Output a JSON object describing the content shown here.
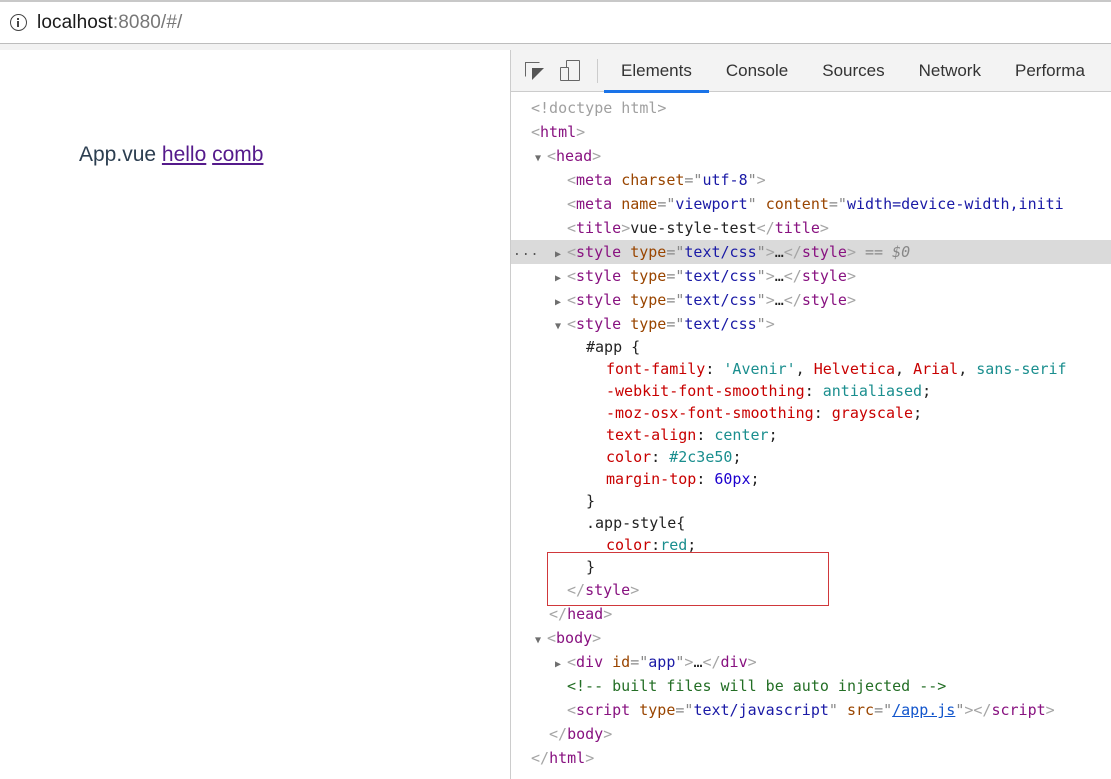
{
  "addressbar": {
    "icon": "info-icon",
    "url_host": "localhost",
    "url_rest": ":8080/#/"
  },
  "page": {
    "text_prefix": "App.vue",
    "links": [
      "hello",
      "comb"
    ]
  },
  "devtools": {
    "toolbar": {
      "icons": [
        "inspect-element-icon",
        "device-toggle-icon"
      ],
      "tabs": [
        {
          "label": "Elements",
          "active": true
        },
        {
          "label": "Console",
          "active": false
        },
        {
          "label": "Sources",
          "active": false
        },
        {
          "label": "Network",
          "active": false
        },
        {
          "label": "Performa",
          "active": false
        }
      ]
    },
    "tree": {
      "doctype": "<!doctype html>",
      "html_open": "html",
      "head_open": "head",
      "meta1": {
        "tag": "meta",
        "attr": "charset",
        "value": "utf-8"
      },
      "meta2": {
        "tag": "meta",
        "attr1": "name",
        "value1": "viewport",
        "attr2": "content",
        "value2": "width=device-width,initi"
      },
      "title": {
        "tag": "title",
        "text": "vue-style-test"
      },
      "style_collapsed": {
        "tag": "style",
        "attr": "type",
        "value": "text/css",
        "ellipsis": "…"
      },
      "selected_marker": "== $0",
      "dots": "...",
      "style_open": {
        "tag": "style",
        "attr": "type",
        "value": "text/css"
      },
      "css": {
        "app_selector": "#app {",
        "rules": [
          {
            "prop": "font-family",
            "values": [
              {
                "text": "'Avenir'",
                "kind": "str"
              },
              {
                "text": ", ",
                "kind": "plain"
              },
              {
                "text": "Helvetica",
                "kind": "red"
              },
              {
                "text": ", ",
                "kind": "plain"
              },
              {
                "text": "Arial",
                "kind": "red"
              },
              {
                "text": ", ",
                "kind": "plain"
              },
              {
                "text": "sans-serif",
                "kind": "kw"
              }
            ]
          },
          {
            "prop": "-webkit-font-smoothing",
            "values": [
              {
                "text": "antialiased",
                "kind": "kw"
              },
              {
                "text": ";",
                "kind": "plain"
              }
            ]
          },
          {
            "prop": "-moz-osx-font-smoothing",
            "values": [
              {
                "text": "grayscale",
                "kind": "red"
              },
              {
                "text": ";",
                "kind": "plain"
              }
            ]
          },
          {
            "prop": "text-align",
            "values": [
              {
                "text": "center",
                "kind": "kw"
              },
              {
                "text": ";",
                "kind": "plain"
              }
            ]
          },
          {
            "prop": "color",
            "values": [
              {
                "text": "#2c3e50",
                "kind": "kw"
              },
              {
                "text": ";",
                "kind": "plain"
              }
            ]
          },
          {
            "prop": "margin-top",
            "values": [
              {
                "text": "60px",
                "kind": "num"
              },
              {
                "text": ";",
                "kind": "plain"
              }
            ]
          }
        ],
        "close_brace": "}",
        "app_style_selector": ".app-style{",
        "app_style_prop": "color",
        "app_style_value": "red"
      },
      "style_close": "style",
      "head_close": "head",
      "body_open": "body",
      "div": {
        "tag": "div",
        "attr": "id",
        "value": "app",
        "ellipsis": "…"
      },
      "comment": "<!-- built files will be auto injected -->",
      "script": {
        "tag": "script",
        "attr1": "type",
        "value1": "text/javascript",
        "attr2": "src",
        "value2": "/app.js"
      },
      "body_close": "body",
      "html_close": "html"
    }
  },
  "colors": {
    "accent": "#1a73e8",
    "highlight_border": "#d0383b",
    "app_text": "#2c3e50",
    "visited_link": "#551a8b"
  }
}
